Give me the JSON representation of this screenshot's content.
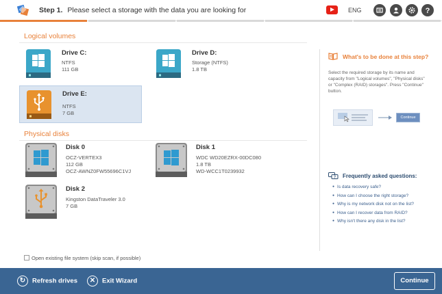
{
  "header": {
    "step_label": "Step 1.",
    "step_text": "Please select a storage with the data you are looking for",
    "language": "ENG",
    "icons": [
      "youtube-icon",
      "media-icon",
      "account-icon",
      "settings-icon",
      "help-icon"
    ]
  },
  "logical": {
    "title": "Logical volumes",
    "drives": [
      {
        "name": "Drive C:",
        "fs": "NTFS",
        "size": "111 GB",
        "icon": "windows-drive-icon"
      },
      {
        "name": "Drive D:",
        "fs": "Storage (NTFS)",
        "size": "1.8 TB",
        "icon": "windows-drive-icon"
      },
      {
        "name": "Drive E:",
        "fs": "NTFS",
        "size": "7 GB",
        "icon": "usb-drive-icon"
      }
    ]
  },
  "physical": {
    "title": "Physical disks",
    "disks": [
      {
        "name": "Disk 0",
        "model": "OCZ-VERTEX3",
        "size": "112 GB",
        "serial": "OCZ-AWNZ0FW55696C1VJ"
      },
      {
        "name": "Disk 1",
        "model": "WDC WD20EZRX-00DC080",
        "size": "1.8 TB",
        "serial": "WD-WCC1T0239932"
      },
      {
        "name": "Disk 2",
        "model": "Kingston DataTraveler 3.0",
        "size": "7 GB"
      }
    ]
  },
  "option": {
    "open_fs": "Open existing file system (skip scan, if possible)"
  },
  "help": {
    "title": "What's to be done at this step?",
    "text": "Select the required storage by its name and capacity from \"Logical volumes\", \"Physical disks\" or \"Complex (RAID) storages\". Press \"Continue\" button.",
    "illustration_button": "Continue",
    "faq_title": "Frequently asked questions:",
    "faq": [
      "Is data recovery safe?",
      "How can I choose the right storage?",
      "Why is my network disk not on the list?",
      "How can I recover data from RAID?",
      "Why isn't there any disk in the list?"
    ]
  },
  "footer": {
    "refresh": "Refresh drives",
    "exit": "Exit Wizard",
    "continue": "Continue"
  },
  "colors": {
    "accent": "#e8813a",
    "footer": "#3a6593",
    "selected": "#dbe5f1"
  }
}
